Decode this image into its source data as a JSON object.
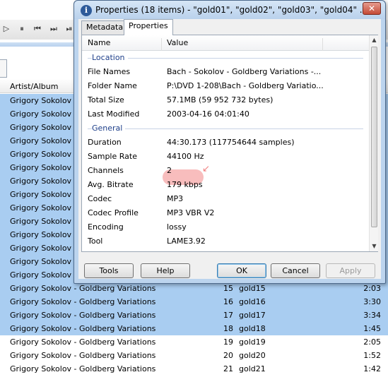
{
  "dialog": {
    "title": "Properties (18 items) - \"gold01\", \"gold02\", \"gold03\", \"gold04\" ...",
    "close_glyph": "✕",
    "tabs": [
      {
        "label": "Metadata"
      },
      {
        "label": "Properties"
      }
    ],
    "columns": {
      "name": "Name",
      "value": "Value"
    },
    "groups": {
      "location": "Location",
      "general": "General"
    },
    "location_rows": [
      {
        "name": "File Names",
        "value": "Bach - Sokolov - Goldberg Variations -..."
      },
      {
        "name": "Folder Name",
        "value": "P:\\DVD 1-208\\Bach - Goldberg Variatio..."
      },
      {
        "name": "Total Size",
        "value": "57.1MB (59 952 732 bytes)"
      },
      {
        "name": "Last Modified",
        "value": "2003-04-16 04:01:40"
      }
    ],
    "general_rows": [
      {
        "name": "Duration",
        "value": "44:30.173",
        "extra": " (117754644 samples)"
      },
      {
        "name": "Sample Rate",
        "value": "44100 Hz"
      },
      {
        "name": "Channels",
        "value": "2"
      },
      {
        "name": "Avg. Bitrate",
        "value": "179 kbps"
      },
      {
        "name": "Codec",
        "value": "MP3"
      },
      {
        "name": "Codec Profile",
        "value": "MP3 VBR V2"
      },
      {
        "name": "Encoding",
        "value": "lossy"
      },
      {
        "name": "Tool",
        "value": "LAME3.92"
      }
    ],
    "buttons": {
      "tools": "Tools",
      "help": "Help",
      "ok": "OK",
      "cancel": "Cancel",
      "apply": "Apply"
    }
  },
  "player": {
    "column_header": "Artist/Album",
    "rows": [
      {
        "artist": "Grigory Sokolov",
        "num": "",
        "title": "",
        "length": "",
        "selected": true
      },
      {
        "artist": "Grigory Sokolov",
        "num": "",
        "title": "",
        "length": "",
        "selected": true
      },
      {
        "artist": "Grigory Sokolov",
        "num": "",
        "title": "",
        "length": "",
        "selected": true
      },
      {
        "artist": "Grigory Sokolov",
        "num": "",
        "title": "",
        "length": "",
        "selected": true
      },
      {
        "artist": "Grigory Sokolov",
        "num": "",
        "title": "",
        "length": "",
        "selected": true
      },
      {
        "artist": "Grigory Sokolov",
        "num": "",
        "title": "",
        "length": "",
        "selected": true
      },
      {
        "artist": "Grigory Sokolov",
        "num": "",
        "title": "",
        "length": "",
        "selected": true
      },
      {
        "artist": "Grigory Sokolov",
        "num": "",
        "title": "",
        "length": "",
        "selected": true
      },
      {
        "artist": "Grigory Sokolov",
        "num": "",
        "title": "",
        "length": "",
        "selected": true
      },
      {
        "artist": "Grigory Sokolov",
        "num": "",
        "title": "",
        "length": "",
        "selected": true
      },
      {
        "artist": "Grigory Sokolov",
        "num": "",
        "title": "",
        "length": "",
        "selected": true
      },
      {
        "artist": "Grigory Sokolov",
        "num": "",
        "title": "",
        "length": "",
        "selected": true
      },
      {
        "artist": "Grigory Sokolov",
        "num": "",
        "title": "",
        "length": "",
        "selected": true
      },
      {
        "artist": "Grigory Sokolov",
        "num": "",
        "title": "",
        "length": "",
        "selected": true
      },
      {
        "artist": "Grigory Sokolov - Goldberg Variations",
        "num": "15",
        "title": "gold15",
        "length": "2:03",
        "selected": true
      },
      {
        "artist": "Grigory Sokolov - Goldberg Variations",
        "num": "16",
        "title": "gold16",
        "length": "3:30",
        "selected": true
      },
      {
        "artist": "Grigory Sokolov - Goldberg Variations",
        "num": "17",
        "title": "gold17",
        "length": "3:34",
        "selected": true
      },
      {
        "artist": "Grigory Sokolov - Goldberg Variations",
        "num": "18",
        "title": "gold18",
        "length": "1:45",
        "selected": true
      },
      {
        "artist": "Grigory Sokolov - Goldberg Variations",
        "num": "19",
        "title": "gold19",
        "length": "2:05",
        "selected": false
      },
      {
        "artist": "Grigory Sokolov - Goldberg Variations",
        "num": "20",
        "title": "gold20",
        "length": "1:52",
        "selected": false
      },
      {
        "artist": "Grigory Sokolov - Goldberg Variations",
        "num": "21",
        "title": "gold21",
        "length": "1:42",
        "selected": false
      }
    ],
    "toolbar_icons": [
      "play-icon",
      "pause-icon",
      "previous-icon",
      "next-icon"
    ]
  },
  "colors": {
    "selection": "#a9cdf1",
    "highlight": "#f7b2b2",
    "group_text": "#1e3f8a"
  }
}
